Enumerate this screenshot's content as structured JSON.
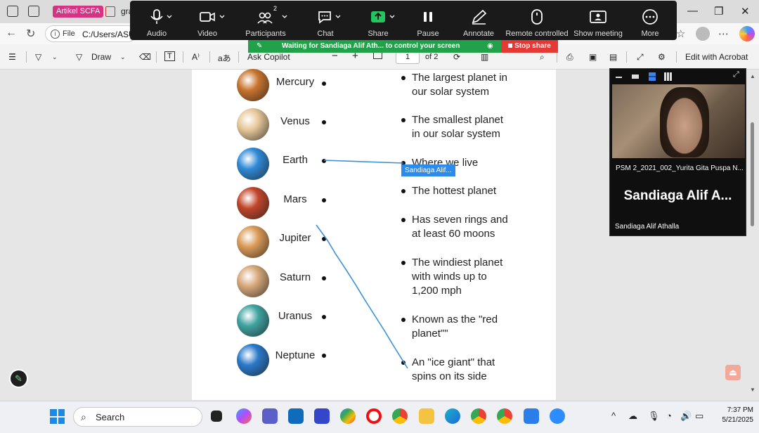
{
  "browser": {
    "tab_group": "Artikel SCFA",
    "tab_title": "gra",
    "address_label": "File",
    "address_url": "C:/Users/ASU"
  },
  "pdf_toolbar": {
    "draw_label": "Draw",
    "copilot_label": "Ask Copilot",
    "zoom_out": "−",
    "zoom_in": "+",
    "page_current": "1",
    "page_total": "of 2",
    "edit_label": "Edit with Acrobat"
  },
  "zoom": {
    "items": [
      {
        "label": "Audio",
        "icon": "microphone-icon"
      },
      {
        "label": "Video",
        "icon": "video-camera-icon"
      },
      {
        "label": "Participants",
        "icon": "participants-icon",
        "count": "2"
      },
      {
        "label": "Chat",
        "icon": "chat-icon"
      },
      {
        "label": "Share",
        "icon": "share-screen-icon"
      },
      {
        "label": "Pause",
        "icon": "pause-icon"
      },
      {
        "label": "Annotate",
        "icon": "pencil-icon"
      },
      {
        "label": "Remote controlled",
        "icon": "mouse-icon"
      },
      {
        "label": "Show meeting",
        "icon": "meeting-window-icon"
      },
      {
        "label": "More",
        "icon": "more-icon"
      }
    ],
    "banner": "Waiting for Sandiaga Alif Ath... to control your screen",
    "stop_share": "Stop share"
  },
  "worksheet": {
    "planets": [
      {
        "name": "Mercury",
        "color": "#c8742e"
      },
      {
        "name": "Venus",
        "color": "#e6c79a"
      },
      {
        "name": "Earth",
        "color": "#2f8ad6"
      },
      {
        "name": "Mars",
        "color": "#c0452a"
      },
      {
        "name": "Jupiter",
        "color": "#d99a57"
      },
      {
        "name": "Saturn",
        "color": "#d6a77a"
      },
      {
        "name": "Uranus",
        "color": "#3fa3a0"
      },
      {
        "name": "Neptune",
        "color": "#2a79c9"
      }
    ],
    "descriptions": [
      "The largest planet in\nour solar system",
      "The smallest planet\nin our solar system",
      "Where we live",
      "The hottest planet",
      "Has seven rings and\nat least 60 moons",
      "The windiest planet\nwith winds up to\n1,200 mph",
      "Known as the \"red\nplanet\"\"",
      "An \"ice giant\" that\nspins on its side"
    ],
    "cursor_tag": "Sandiaga Alif..."
  },
  "video_panel": {
    "tile1_name": "PSM 2_2021_002_Yurita Gita Puspa N...",
    "tile2_big": "Sandiaga Alif A...",
    "tile2_name": "Sandiaga Alif Athalla"
  },
  "taskbar": {
    "search_placeholder": "Search",
    "time": "7:37 PM",
    "date": "5/21/2025"
  }
}
